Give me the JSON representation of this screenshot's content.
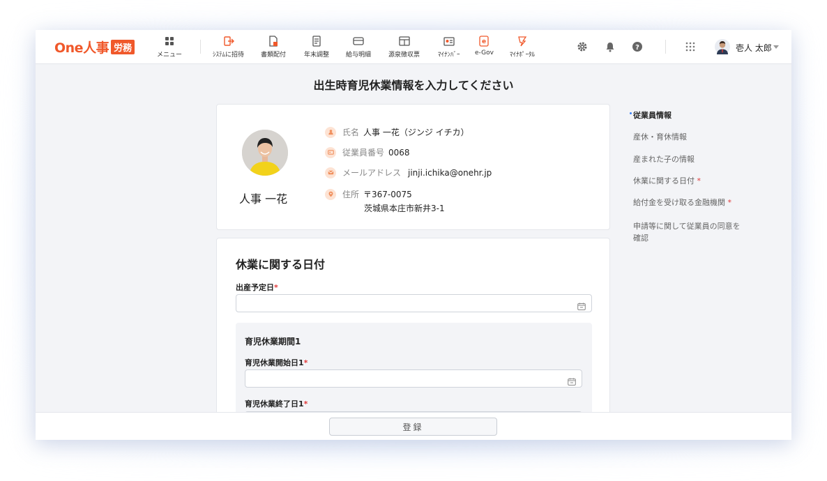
{
  "header": {
    "logo_text": "One人事",
    "logo_badge": "労務",
    "menu_label": "メニュー",
    "nav": [
      {
        "label": "ｼｽﾃﾑに招待",
        "icon": "invite-icon"
      },
      {
        "label": "書類配付",
        "icon": "document-distribute-icon"
      },
      {
        "label": "年末調整",
        "icon": "year-end-adjust-icon"
      },
      {
        "label": "給与明細",
        "icon": "payslip-icon"
      },
      {
        "label": "源泉徴収票",
        "icon": "withholding-slip-icon"
      },
      {
        "label": "ﾏｲﾅﾝﾊﾞｰ",
        "icon": "my-number-icon"
      },
      {
        "label": "e-Gov",
        "icon": "egov-icon"
      },
      {
        "label": "ﾏｲﾅﾎﾟｰﾀﾙ",
        "icon": "myna-portal-icon"
      }
    ],
    "user_name": "壱人 太郎"
  },
  "page_title": "出生時育児休業情報を入力してください",
  "employee": {
    "name_display": "人事 一花",
    "name_label": "氏名",
    "name_value": "人事 一花（ジンジ イチカ）",
    "number_label": "従業員番号",
    "number_value": "0068",
    "email_label": "メールアドレス",
    "email_value": "jinji.ichika@onehr.jp",
    "address_label": "住所",
    "address_zip": "〒367-0075",
    "address_line": "茨城県本庄市新井3-1"
  },
  "leave_section": {
    "title": "休業に関する日付",
    "due_date_label": "出産予定日",
    "required_mark": "*",
    "period_title": "育児休業期間1",
    "start_label": "育児休業開始日1",
    "end_label": "育児休業終了日1"
  },
  "sidenav": [
    {
      "label": "従業員情報",
      "required": ""
    },
    {
      "label": "産休・育休情報",
      "required": ""
    },
    {
      "label": "産まれた子の情報",
      "required": ""
    },
    {
      "label": "休業に関する日付",
      "required": "*"
    },
    {
      "label": "給付金を受け取る金融機関",
      "required": "*"
    },
    {
      "label": "申請等に関して従業員の同意を",
      "required": ""
    },
    {
      "label": "確認",
      "required": ""
    }
  ],
  "footer": {
    "submit_label": "登録"
  },
  "colors": {
    "brand": "#f0582a",
    "required": "#e03a3a",
    "active_dot": "#3b82f6"
  }
}
